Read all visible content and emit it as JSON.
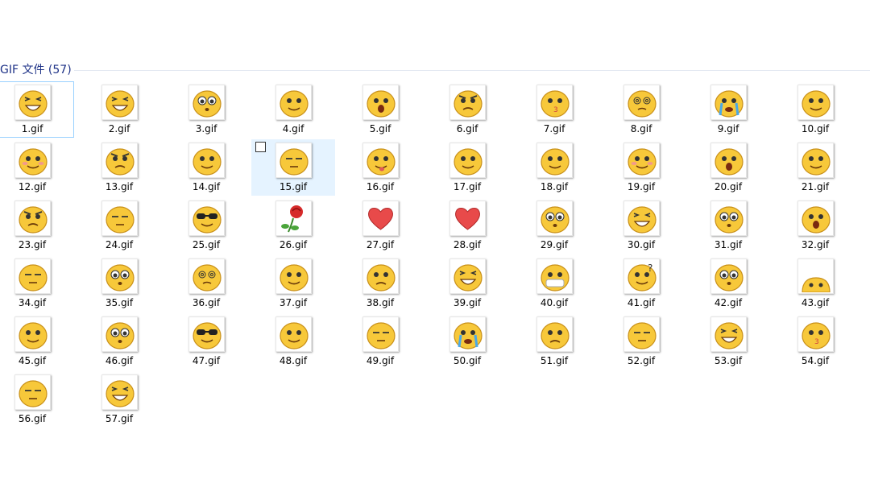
{
  "group": {
    "title": "GIF 文件 (57)"
  },
  "selection": {
    "focused": "1.gif",
    "hovered": "15.gif"
  },
  "colors": {
    "face": "#f7c83a",
    "face_edge": "#c8901a",
    "heart": "#e84a4a"
  },
  "files": [
    {
      "name": "1.gif",
      "icon": "laugh-squint-icon"
    },
    {
      "name": "2.gif",
      "icon": "grin-icon"
    },
    {
      "name": "3.gif",
      "icon": "wide-eyes-icon"
    },
    {
      "name": "4.gif",
      "icon": "eyepatch-icon"
    },
    {
      "name": "5.gif",
      "icon": "shocked-icon"
    },
    {
      "name": "6.gif",
      "icon": "angry-icon"
    },
    {
      "name": "7.gif",
      "icon": "kiss-icon"
    },
    {
      "name": "8.gif",
      "icon": "dizzy-icon"
    },
    {
      "name": "9.gif",
      "icon": "crying-icon"
    },
    {
      "name": "10.gif",
      "icon": "smirk-icon"
    },
    {
      "name": "12.gif",
      "icon": "blush-icon"
    },
    {
      "name": "13.gif",
      "icon": "furious-icon"
    },
    {
      "name": "14.gif",
      "icon": "thinking-icon"
    },
    {
      "name": "15.gif",
      "icon": "sleepy-icon"
    },
    {
      "name": "16.gif",
      "icon": "tongue-icon"
    },
    {
      "name": "17.gif",
      "icon": "wink-icon"
    },
    {
      "name": "18.gif",
      "icon": "sweat-icon"
    },
    {
      "name": "19.gif",
      "icon": "bow-icon"
    },
    {
      "name": "20.gif",
      "icon": "scream-icon"
    },
    {
      "name": "21.gif",
      "icon": "cover-mouth-icon"
    },
    {
      "name": "23.gif",
      "icon": "pout-icon"
    },
    {
      "name": "24.gif",
      "icon": "relieved-icon"
    },
    {
      "name": "25.gif",
      "icon": "sunglasses-icon"
    },
    {
      "name": "26.gif",
      "icon": "rose-icon"
    },
    {
      "name": "27.gif",
      "icon": "heart-icon"
    },
    {
      "name": "28.gif",
      "icon": "heart-icon"
    },
    {
      "name": "29.gif",
      "icon": "star-eyes-icon"
    },
    {
      "name": "30.gif",
      "icon": "grin-icon"
    },
    {
      "name": "31.gif",
      "icon": "wide-eyes-icon"
    },
    {
      "name": "32.gif",
      "icon": "shout-icon"
    },
    {
      "name": "34.gif",
      "icon": "content-icon"
    },
    {
      "name": "35.gif",
      "icon": "surprised-icon"
    },
    {
      "name": "36.gif",
      "icon": "dizzy-icon"
    },
    {
      "name": "37.gif",
      "icon": "thinking-icon"
    },
    {
      "name": "38.gif",
      "icon": "dazed-icon"
    },
    {
      "name": "39.gif",
      "icon": "big-laugh-icon"
    },
    {
      "name": "40.gif",
      "icon": "mask-icon"
    },
    {
      "name": "41.gif",
      "icon": "question-icon"
    },
    {
      "name": "42.gif",
      "icon": "wonder-icon"
    },
    {
      "name": "43.gif",
      "icon": "peek-icon"
    },
    {
      "name": "45.gif",
      "icon": "rolling-eyes-icon"
    },
    {
      "name": "46.gif",
      "icon": "awe-icon"
    },
    {
      "name": "47.gif",
      "icon": "sunglasses-icon"
    },
    {
      "name": "48.gif",
      "icon": "smile-icon"
    },
    {
      "name": "49.gif",
      "icon": "meh-icon"
    },
    {
      "name": "50.gif",
      "icon": "crying-icon"
    },
    {
      "name": "51.gif",
      "icon": "sad-icon"
    },
    {
      "name": "52.gif",
      "icon": "sleeping-icon"
    },
    {
      "name": "53.gif",
      "icon": "grimace-icon"
    },
    {
      "name": "54.gif",
      "icon": "kiss-icon"
    },
    {
      "name": "56.gif",
      "icon": "unamused-icon"
    },
    {
      "name": "57.gif",
      "icon": "big-laugh-icon"
    }
  ]
}
